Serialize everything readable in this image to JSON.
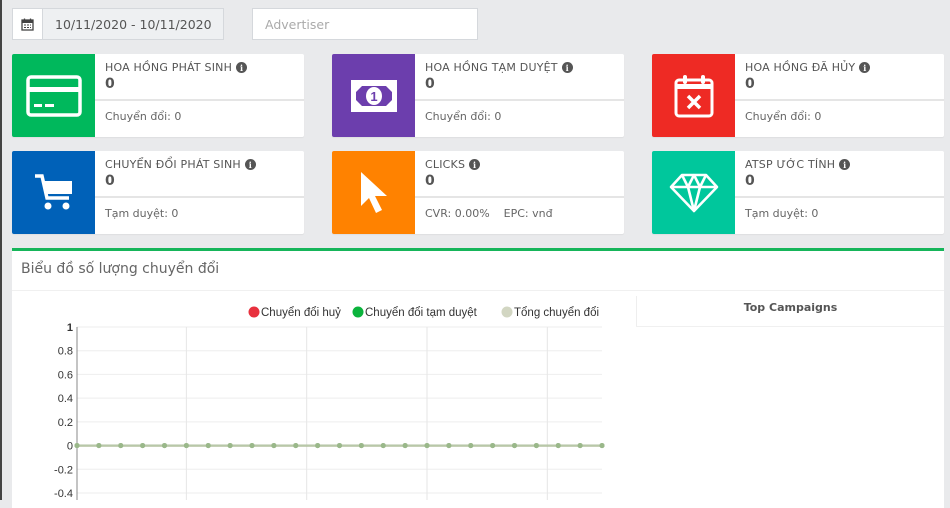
{
  "filters": {
    "date_range": "10/11/2020 - 10/11/2020",
    "advertiser_placeholder": "Advertiser",
    "calendar_icon": "calendar-icon"
  },
  "cards": [
    {
      "title": "HOA HỒNG PHÁT SINH",
      "value": "0",
      "footer": [
        "Chuyển đổi: 0"
      ],
      "color": "#00b85c",
      "icon": "credit-card-icon"
    },
    {
      "title": "HOA HỒNG TẠM DUYỆT",
      "value": "0",
      "footer": [
        "Chuyển đổi: 0"
      ],
      "color": "#6c3ead",
      "icon": "money-bill-icon"
    },
    {
      "title": "HOA HỒNG ĐÃ HỦY",
      "value": "0",
      "footer": [
        "Chuyển đổi: 0"
      ],
      "color": "#ee2a24",
      "icon": "calendar-x-icon"
    },
    {
      "title": "CHUYỂN ĐỔI PHÁT SINH",
      "value": "0",
      "footer": [
        "Tạm duyệt: 0"
      ],
      "color": "#0061b8",
      "icon": "cart-icon"
    },
    {
      "title": "CLICKS",
      "value": "0",
      "footer": [
        "CVR: 0.00%",
        "EPC: vnđ"
      ],
      "color": "#ff8200",
      "icon": "cursor-icon"
    },
    {
      "title": "ATSP ƯỚC TÍNH",
      "value": "0",
      "footer": [
        "Tạm duyệt: 0"
      ],
      "color": "#00c79c",
      "icon": "diamond-icon"
    }
  ],
  "panel": {
    "title": "Biểu đồ số lượng chuyển đổi",
    "top_campaigns": "Top Campaigns"
  },
  "chart_data": {
    "type": "line",
    "ylim": [
      -0.4,
      1
    ],
    "yticks": [
      "1",
      "0.8",
      "0.6",
      "0.4",
      "0.2",
      "0",
      "-0.2",
      "-0.4"
    ],
    "grid": true,
    "legend_placement": "top",
    "series": [
      {
        "name": "Chuyển đổi huỷ",
        "color": "#e8313e",
        "values": [
          0,
          0,
          0,
          0,
          0,
          0,
          0,
          0,
          0,
          0,
          0,
          0,
          0,
          0,
          0,
          0,
          0,
          0,
          0,
          0,
          0,
          0,
          0,
          0,
          0
        ]
      },
      {
        "name": "Chuyển đổi tạm duyệt",
        "color": "#0bb33c",
        "values": [
          0,
          0,
          0,
          0,
          0,
          0,
          0,
          0,
          0,
          0,
          0,
          0,
          0,
          0,
          0,
          0,
          0,
          0,
          0,
          0,
          0,
          0,
          0,
          0,
          0
        ]
      },
      {
        "name": "Tổng chuyển đổi",
        "color": "#d2d6c2",
        "values": [
          0,
          0,
          0,
          0,
          0,
          0,
          0,
          0,
          0,
          0,
          0,
          0,
          0,
          0,
          0,
          0,
          0,
          0,
          0,
          0,
          0,
          0,
          0,
          0,
          0
        ]
      }
    ]
  }
}
